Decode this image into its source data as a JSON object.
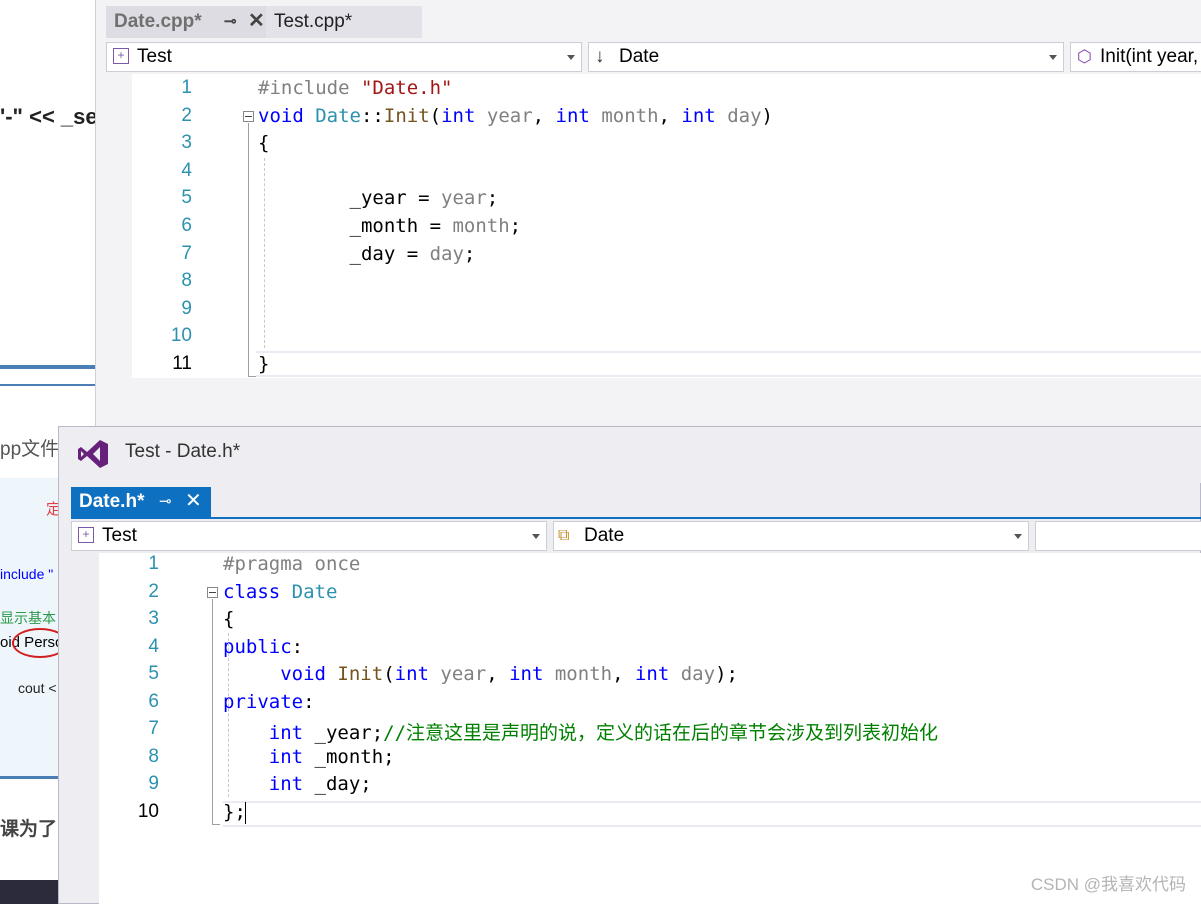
{
  "background_window": {
    "fragments": [
      "'-\" << _se",
      "pp文件",
      "定",
      "include \"",
      "显示基本",
      "oid Perso",
      "cout <",
      "课为了"
    ]
  },
  "top_editor": {
    "tabs": [
      {
        "label": "Date.cpp*",
        "active": false
      },
      {
        "label": "Test.cpp*",
        "active": false
      }
    ],
    "navbar": {
      "project": "Test",
      "scope": "Date",
      "member": "Init(int year,"
    },
    "line_numbers": [
      "1",
      "2",
      "3",
      "4",
      "5",
      "6",
      "7",
      "8",
      "9",
      "10",
      "11"
    ],
    "code_lines": [
      [
        {
          "t": "#include ",
          "c": "pp"
        },
        {
          "t": "\"Date.h\"",
          "c": "str"
        }
      ],
      [
        {
          "t": "void",
          "c": "kw"
        },
        {
          "t": " ",
          "c": ""
        },
        {
          "t": "Date",
          "c": "ty"
        },
        {
          "t": "::",
          "c": ""
        },
        {
          "t": "Init",
          "c": "fn"
        },
        {
          "t": "(",
          "c": ""
        },
        {
          "t": "int",
          "c": "kw"
        },
        {
          "t": " ",
          "c": ""
        },
        {
          "t": "year",
          "c": "pm"
        },
        {
          "t": ", ",
          "c": ""
        },
        {
          "t": "int",
          "c": "kw"
        },
        {
          "t": " ",
          "c": ""
        },
        {
          "t": "month",
          "c": "pm"
        },
        {
          "t": ", ",
          "c": ""
        },
        {
          "t": "int",
          "c": "kw"
        },
        {
          "t": " ",
          "c": ""
        },
        {
          "t": "day",
          "c": "pm"
        },
        {
          "t": ")",
          "c": ""
        }
      ],
      [
        {
          "t": "{",
          "c": ""
        }
      ],
      [],
      [
        {
          "t": "        _year = ",
          "c": ""
        },
        {
          "t": "year",
          "c": "pm"
        },
        {
          "t": ";",
          "c": ""
        }
      ],
      [
        {
          "t": "        _month = ",
          "c": ""
        },
        {
          "t": "month",
          "c": "pm"
        },
        {
          "t": ";",
          "c": ""
        }
      ],
      [
        {
          "t": "        _day = ",
          "c": ""
        },
        {
          "t": "day",
          "c": "pm"
        },
        {
          "t": ";",
          "c": ""
        }
      ],
      [],
      [],
      [],
      [
        {
          "t": "}",
          "c": ""
        }
      ]
    ]
  },
  "bottom_window": {
    "title": "Test - Date.h*",
    "tab": {
      "label": "Date.h*",
      "active": true
    },
    "navbar": {
      "project": "Test",
      "scope": "Date",
      "member": ""
    },
    "line_numbers": [
      "1",
      "2",
      "3",
      "4",
      "5",
      "6",
      "7",
      "8",
      "9",
      "10"
    ],
    "code_lines": [
      [
        {
          "t": "#pragma once",
          "c": "pp"
        }
      ],
      [
        {
          "t": "class",
          "c": "kw"
        },
        {
          "t": " ",
          "c": ""
        },
        {
          "t": "Date",
          "c": "ty"
        }
      ],
      [
        {
          "t": "{",
          "c": ""
        }
      ],
      [
        {
          "t": "public",
          "c": "kw"
        },
        {
          "t": ":",
          "c": ""
        }
      ],
      [
        {
          "t": "     ",
          "c": ""
        },
        {
          "t": "void",
          "c": "kw"
        },
        {
          "t": " ",
          "c": ""
        },
        {
          "t": "Init",
          "c": "fn"
        },
        {
          "t": "(",
          "c": ""
        },
        {
          "t": "int",
          "c": "kw"
        },
        {
          "t": " ",
          "c": ""
        },
        {
          "t": "year",
          "c": "pm"
        },
        {
          "t": ", ",
          "c": ""
        },
        {
          "t": "int",
          "c": "kw"
        },
        {
          "t": " ",
          "c": ""
        },
        {
          "t": "month",
          "c": "pm"
        },
        {
          "t": ", ",
          "c": ""
        },
        {
          "t": "int",
          "c": "kw"
        },
        {
          "t": " ",
          "c": ""
        },
        {
          "t": "day",
          "c": "pm"
        },
        {
          "t": ");",
          "c": ""
        }
      ],
      [
        {
          "t": "private",
          "c": "kw"
        },
        {
          "t": ":",
          "c": ""
        }
      ],
      [
        {
          "t": "    ",
          "c": ""
        },
        {
          "t": "int",
          "c": "kw"
        },
        {
          "t": " _year;",
          "c": ""
        },
        {
          "t": "//注意这里是声明的说，定义的话在后的章节会涉及到列表初始化",
          "c": "cm"
        }
      ],
      [
        {
          "t": "    ",
          "c": ""
        },
        {
          "t": "int",
          "c": "kw"
        },
        {
          "t": " _month;",
          "c": ""
        }
      ],
      [
        {
          "t": "    ",
          "c": ""
        },
        {
          "t": "int",
          "c": "kw"
        },
        {
          "t": " _day;",
          "c": ""
        }
      ],
      [
        {
          "t": "};",
          "c": ""
        }
      ]
    ]
  },
  "watermark": "CSDN @我喜欢代码",
  "colors": {
    "keyword": "#0000ff",
    "string": "#a31515",
    "type": "#2b91af",
    "comment": "#008000",
    "active_tab": "#0e70c0",
    "vs_logo": "#68217a"
  },
  "icons": {
    "project": "cpp-project-icon",
    "scope_top": "down-arrow-icon",
    "member_top": "method-cube-icon",
    "scope_bottom": "class-icon",
    "pin": "pin-icon",
    "close": "close-icon"
  }
}
